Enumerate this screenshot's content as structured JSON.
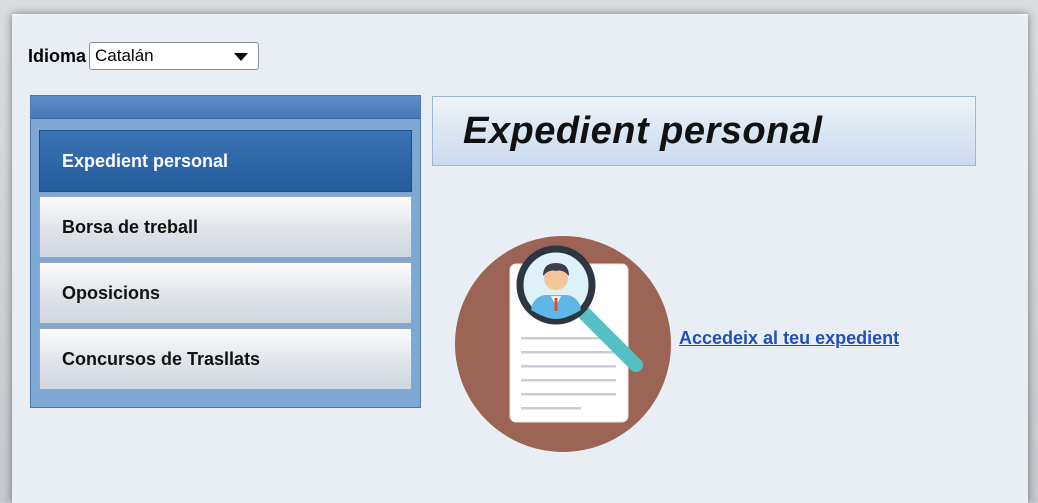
{
  "language": {
    "label": "Idioma",
    "selected": "Catalán"
  },
  "menu": {
    "items": [
      {
        "label": "Expedient personal",
        "active": true
      },
      {
        "label": "Borsa de treball",
        "active": false
      },
      {
        "label": "Oposicions",
        "active": false
      },
      {
        "label": "Concursos de Trasllats",
        "active": false
      }
    ]
  },
  "main": {
    "title": "Expedient personal",
    "link_text": "Accedeix al teu expedient",
    "icon": "document-search-icon"
  },
  "colors": {
    "active_item": "#2a62a4",
    "link": "#1f4fbf",
    "panel_bg": "#e9eef5",
    "icon_circle": "#9b6455"
  }
}
